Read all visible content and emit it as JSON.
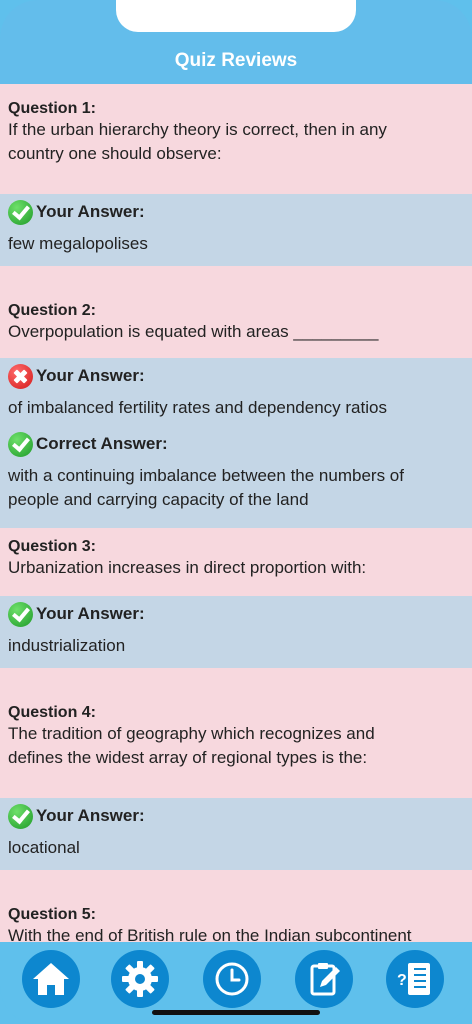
{
  "header": {
    "title": "Quiz Reviews"
  },
  "questions": [
    {
      "label": "Question 1:",
      "text_lines": [
        "If the urban hierarchy theory is correct, then in any",
        "country one should observe:"
      ],
      "your_answer_label": "Your Answer:",
      "your_answer": "few megalopolises",
      "status": "correct"
    },
    {
      "label": "Question 2:",
      "text_lines": [
        "Overpopulation is equated with areas _________"
      ],
      "your_answer_label": "Your Answer:",
      "your_answer": "of imbalanced fertility rates and dependency ratios",
      "status": "incorrect",
      "correct_answer_label": "Correct Answer:",
      "correct_answer_lines": [
        "with a continuing imbalance between the numbers of",
        "people and carrying capacity of the land"
      ]
    },
    {
      "label": "Question 3:",
      "text_lines": [
        "Urbanization increases in direct proportion with:"
      ],
      "your_answer_label": "Your Answer:",
      "your_answer": "industrialization",
      "status": "correct"
    },
    {
      "label": "Question 4:",
      "text_lines": [
        "The tradition of geography which recognizes and",
        "defines the widest array of regional types is the:"
      ],
      "your_answer_label": "Your Answer:",
      "your_answer": "locational",
      "status": "correct"
    },
    {
      "label": "Question 5:",
      "text_lines": [
        "With the end of British rule on the Indian subcontinent"
      ]
    }
  ],
  "tabbar": {
    "icons": [
      "home-icon",
      "gear-icon",
      "clock-icon",
      "edit-icon",
      "quiz-list-icon"
    ]
  }
}
